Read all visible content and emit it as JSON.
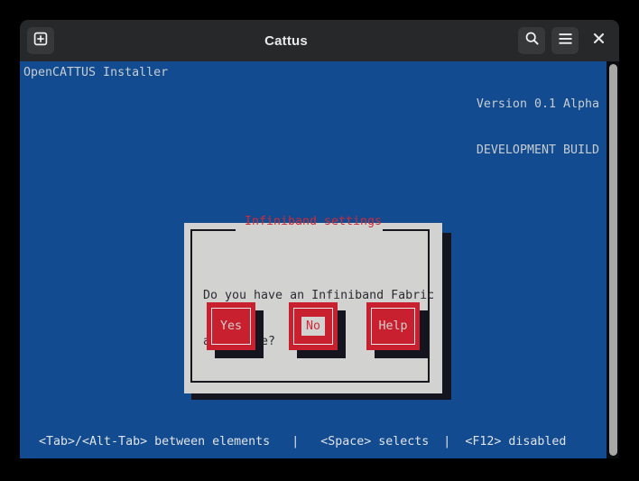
{
  "window": {
    "title": "Cattus",
    "titlebar_buttons": {
      "new_tab": "new-tab-icon",
      "search": "search-icon",
      "menu": "hamburger-menu-icon",
      "close": "×"
    }
  },
  "terminal": {
    "header_left": "OpenCATTUS Installer",
    "header_right_line1": "Version 0.1 Alpha",
    "header_right_line2": "DEVELOPMENT BUILD",
    "footer": "<Tab>/<Alt-Tab> between elements   |   <Space> selects  |  <F12> disabled",
    "colors": {
      "background": "#124b8f",
      "text": "#c7ccd1"
    }
  },
  "dialog": {
    "title": "Infiniband settings",
    "message_line1": "Do you have an Infiniband Fabric",
    "message_line2": "available?",
    "buttons": [
      {
        "label": "Yes",
        "focused": false
      },
      {
        "label": "No",
        "focused": true
      },
      {
        "label": "Help",
        "focused": false
      }
    ],
    "colors": {
      "panel": "#d2d2d0",
      "title": "#cf2a3a",
      "button": "#c9202f",
      "shadow": "#14151f"
    }
  }
}
